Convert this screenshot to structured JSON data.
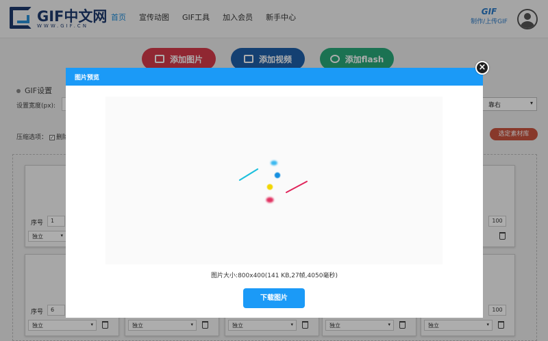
{
  "header": {
    "logo_text": "GIF中文网",
    "logo_sub": "WWW.GIF.CN",
    "nav": [
      {
        "label": "首页",
        "active": true
      },
      {
        "label": "宣传动图",
        "active": false
      },
      {
        "label": "GIF工具",
        "active": false
      },
      {
        "label": "加入会员",
        "active": false
      },
      {
        "label": "新手中心",
        "active": false
      }
    ],
    "upload_badge": "GIF",
    "upload_label": "制作/上传GIF"
  },
  "toolbar": {
    "add_image": "添加图片",
    "add_video": "添加视频",
    "add_flash": "添加flash"
  },
  "settings": {
    "title": "GIF设置",
    "width_label": "设置宽度(px):",
    "align_value": "靠右",
    "compress_label": "压缩选项：",
    "compress_option": "删除",
    "select_material": "选定素材库"
  },
  "frames": {
    "index_label": "序号",
    "mode_value": "独立",
    "row1": {
      "index": "1",
      "delay": "100"
    },
    "row2": {
      "index": "6",
      "delay": "100"
    }
  },
  "modal": {
    "title": "图片预览",
    "close_symbol": "×",
    "size_info": "图片大小:800x400(141 KB,27帧,4050毫秒)",
    "download_label": "下载图片"
  },
  "colors": {
    "primary": "#1b9af7",
    "add_image": "#d53a4a",
    "add_video": "#1e5fa8",
    "add_flash": "#28a87a"
  }
}
